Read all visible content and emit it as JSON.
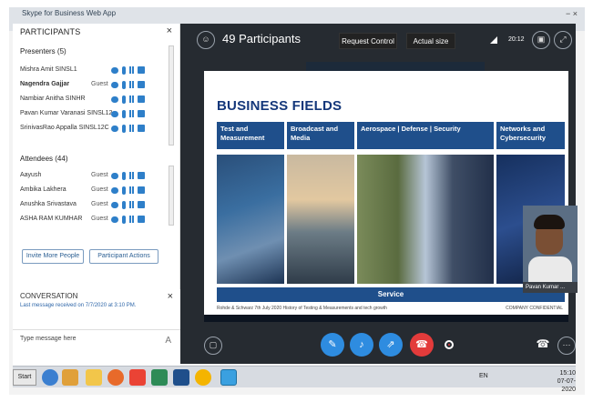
{
  "window": {
    "app_title": "Skype for Business Web App",
    "controls": "−  ×"
  },
  "participants_panel": {
    "title": "PARTICIPANTS",
    "presenters_label": "Presenters (5)",
    "presenters": [
      {
        "name": "Mishra Amit SINSL1",
        "guest": ""
      },
      {
        "name": "Nagendra Gajjar",
        "guest": "Guest"
      },
      {
        "name": "Nambiar Anitha SINHR",
        "guest": ""
      },
      {
        "name": "Pavan Kumar Varanasi SINSL12",
        "guest": ""
      },
      {
        "name": "SrinivasRao Appalla SINSL12C",
        "guest": ""
      }
    ],
    "attendees_label": "Attendees (44)",
    "attendees": [
      {
        "name": "Aayush",
        "guest": "Guest"
      },
      {
        "name": "Ambika Lakhera",
        "guest": "Guest"
      },
      {
        "name": "Anushka Srivastava",
        "guest": "Guest"
      },
      {
        "name": "ASHA RAM KUMHAR",
        "guest": "Guest"
      }
    ],
    "invite_button": "Invite More People",
    "actions_button": "Participant Actions"
  },
  "conversation": {
    "title": "CONVERSATION",
    "last_message": "Last message received on 7/7/2020 at 3:10 PM.",
    "input_placeholder": "Type message here",
    "format_glyph": "A"
  },
  "stage": {
    "participants_count": "49 Participants",
    "request_control": "Request Control",
    "actual_size": "Actual size",
    "time": "20:12",
    "slide": {
      "title": "BUSINESS FIELDS",
      "fields": [
        {
          "label": "Test and Measurement"
        },
        {
          "label": "Broadcast and Media"
        },
        {
          "label": "Aerospace | Defense | Security"
        },
        {
          "label": "Networks and Cybersecurity"
        }
      ],
      "service_label": "Service",
      "footer_left": "Rohde & Schwarz  7th July 2020  History of Testing & Measurements and tech growth",
      "footer_right": "COMPANY CONFIDENTIAL"
    },
    "presenter_label": "Pavan Kumar ..."
  },
  "taskbar": {
    "start": "Start",
    "language": "EN",
    "clock_time": "15:10",
    "clock_date": "07-07-2020"
  },
  "colors": {
    "brand_blue": "#1f4f8b",
    "call_blue": "#2e8ce0",
    "end_red": "#e33b3b",
    "stage_bg": "#262b31"
  }
}
